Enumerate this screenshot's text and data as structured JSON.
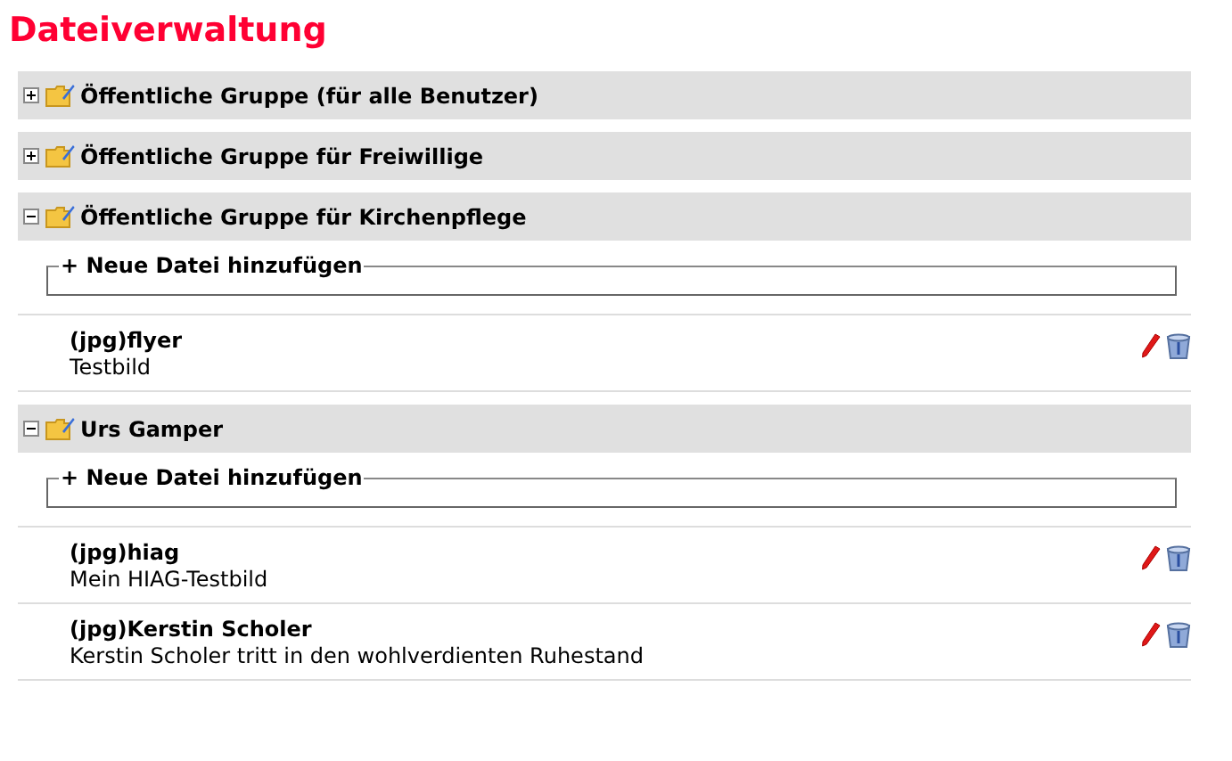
{
  "title": "Dateiverwaltung",
  "groups": [
    {
      "name": "Öffentliche Gruppe (für alle Benutzer)",
      "expanded": false
    },
    {
      "name": "Öffentliche Gruppe für Freiwillige",
      "expanded": false
    },
    {
      "name": "Öffentliche Gruppe für Kirchenpflege",
      "expanded": true,
      "add_label": "+ Neue Datei hinzufügen",
      "files": [
        {
          "name": "(jpg)flyer",
          "description": "Testbild"
        }
      ]
    },
    {
      "name": "Urs Gamper",
      "expanded": true,
      "add_label": "+ Neue Datei hinzufügen",
      "files": [
        {
          "name": "(jpg)hiag",
          "description": "Mein HIAG-Testbild"
        },
        {
          "name": "(jpg)Kerstin Scholer",
          "description": "Kerstin Scholer tritt in den wohlverdienten Ruhestand"
        }
      ]
    }
  ]
}
